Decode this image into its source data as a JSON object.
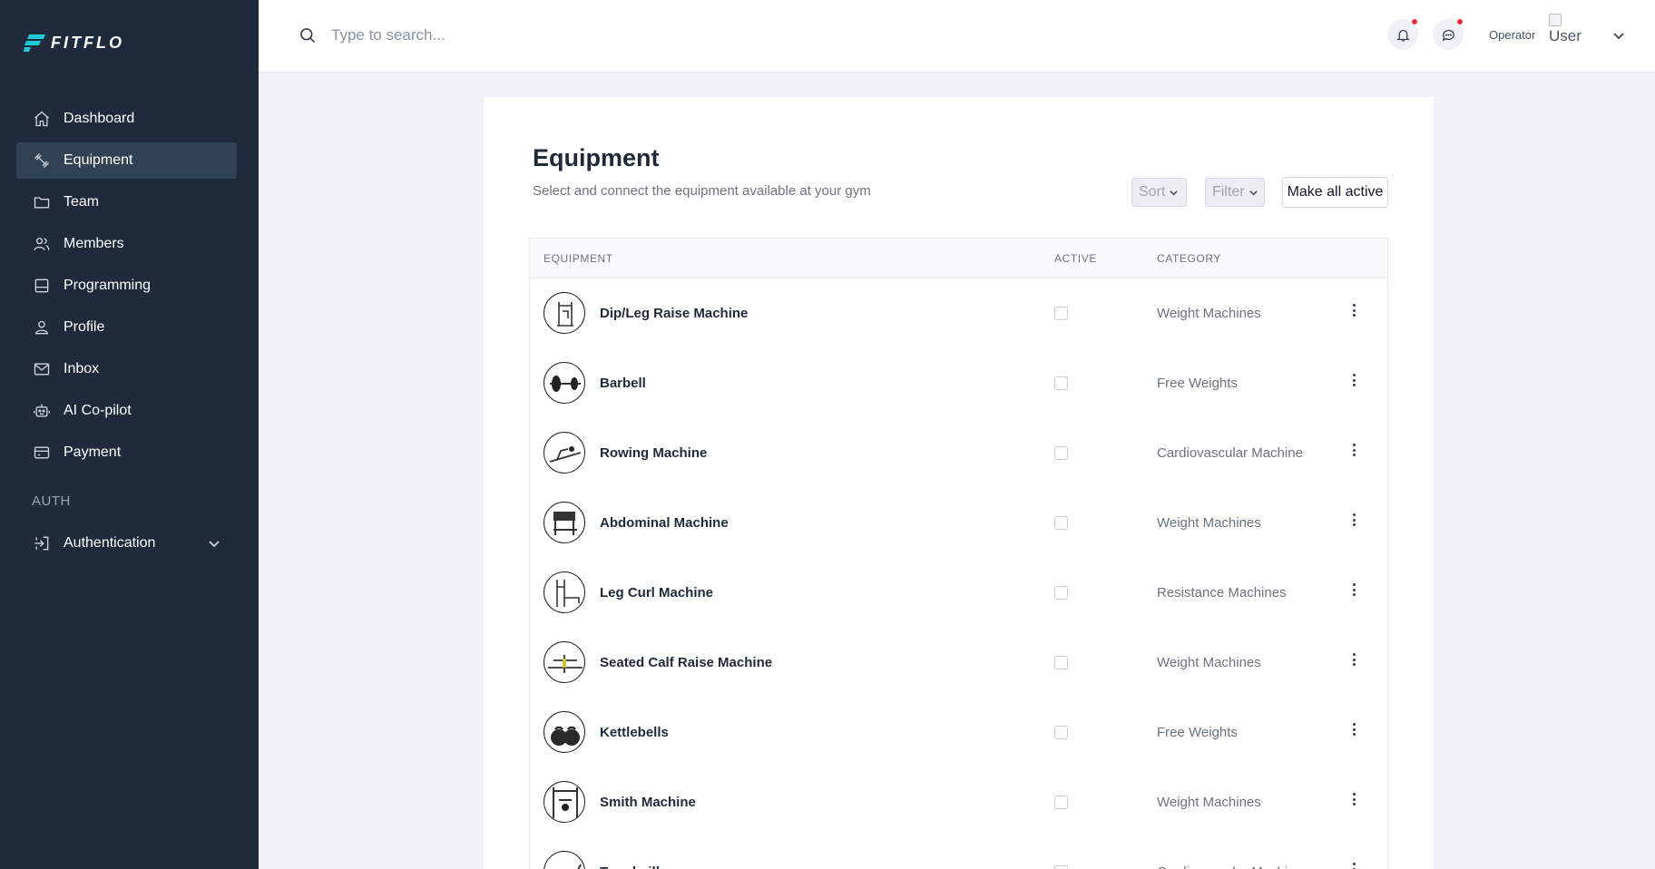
{
  "brand": {
    "name": "FITFLO",
    "accent": "#1ecad3"
  },
  "sidebar": {
    "items": [
      {
        "label": "Dashboard",
        "icon": "home-icon"
      },
      {
        "label": "Equipment",
        "icon": "dumbbell-icon",
        "active": true
      },
      {
        "label": "Team",
        "icon": "folder-icon"
      },
      {
        "label": "Members",
        "icon": "users-icon"
      },
      {
        "label": "Programming",
        "icon": "layout-icon"
      },
      {
        "label": "Profile",
        "icon": "user-icon"
      },
      {
        "label": "Inbox",
        "icon": "mail-icon"
      },
      {
        "label": "AI Co-pilot",
        "icon": "robot-icon"
      },
      {
        "label": "Payment",
        "icon": "credit-card-icon"
      }
    ],
    "section_label": "AUTH",
    "auth_item": {
      "label": "Authentication",
      "icon": "login-icon"
    }
  },
  "header": {
    "search_placeholder": "Type to search...",
    "user_role": "Operator",
    "avatar_alt": "User"
  },
  "page": {
    "title": "Equipment",
    "subtitle": "Select and connect the equipment available at your gym",
    "sort_label": "Sort",
    "filter_label": "Filter",
    "make_all_active_label": "Make all active"
  },
  "table": {
    "columns": [
      "EQUIPMENT",
      "ACTIVE",
      "CATEGORY"
    ],
    "rows": [
      {
        "name": "Dip/Leg Raise Machine",
        "active": false,
        "category": "Weight Machines"
      },
      {
        "name": "Barbell",
        "active": false,
        "category": "Free Weights"
      },
      {
        "name": "Rowing Machine",
        "active": false,
        "category": "Cardiovascular Machine"
      },
      {
        "name": "Abdominal Machine",
        "active": false,
        "category": "Weight Machines"
      },
      {
        "name": "Leg Curl Machine",
        "active": false,
        "category": "Resistance Machines"
      },
      {
        "name": "Seated Calf Raise Machine",
        "active": false,
        "category": "Weight Machines"
      },
      {
        "name": "Kettlebells",
        "active": false,
        "category": "Free Weights"
      },
      {
        "name": "Smith Machine",
        "active": false,
        "category": "Weight Machines"
      },
      {
        "name": "Treadmill",
        "active": false,
        "category": "Cardiovascular Machine"
      }
    ]
  }
}
